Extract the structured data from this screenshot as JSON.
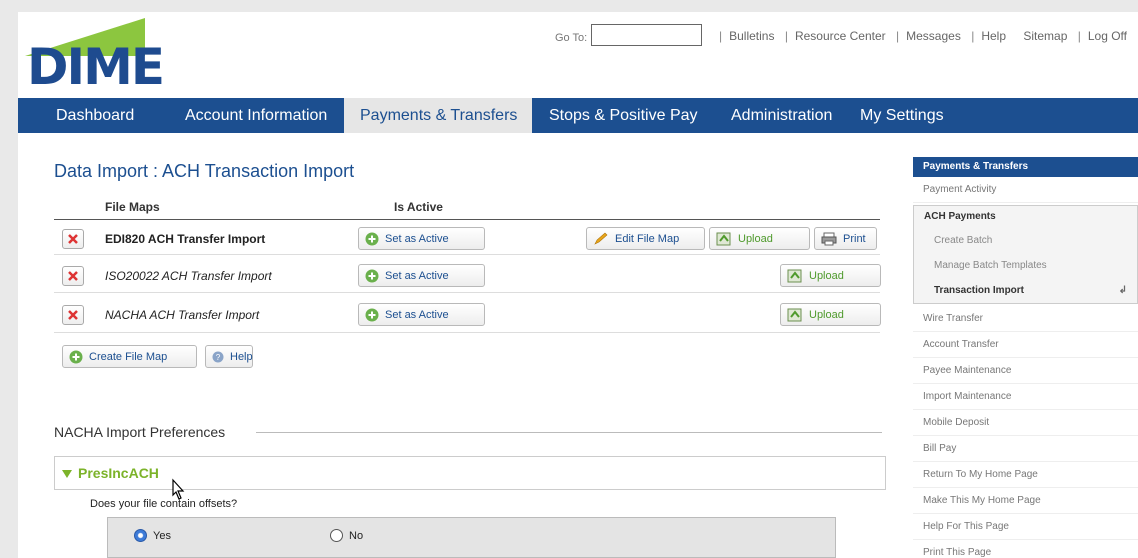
{
  "brand": {
    "logo_text": "DIME",
    "colors": {
      "primary": "#1c4f90",
      "accent_green": "#7cb32a"
    }
  },
  "header": {
    "goto_label": "Go To:",
    "goto_value": "",
    "links": [
      "Bulletins",
      "Resource Center",
      "Messages",
      "Help",
      "Sitemap",
      "Log Off"
    ]
  },
  "nav": {
    "items": [
      "Dashboard",
      "Account Information",
      "Payments & Transfers",
      "Stops & Positive Pay",
      "Administration",
      "My Settings"
    ],
    "active": "Payments & Transfers"
  },
  "main": {
    "title": "Data Import : ACH Transaction Import",
    "table": {
      "col_file_maps": "File Maps",
      "col_is_active": "Is Active",
      "rows": [
        {
          "name": "EDI820 ACH Transfer Import",
          "set_active": "Set as Active",
          "edit": "Edit File Map",
          "upload": "Upload",
          "print": "Print"
        },
        {
          "name": "ISO20022 ACH Transfer Import",
          "set_active": "Set as Active",
          "upload": "Upload"
        },
        {
          "name": "NACHA ACH Transfer Import",
          "set_active": "Set as Active",
          "upload": "Upload"
        }
      ]
    },
    "create_file_map": "Create File Map",
    "help": "Help",
    "prefs_title": "NACHA Import Preferences",
    "collapse_title": "PresIncACH",
    "question": "Does your file contain offsets?",
    "radio_yes": "Yes",
    "radio_no": "No",
    "radio_selected": "Yes"
  },
  "sidebar": {
    "header": "Payments & Transfers",
    "payment_activity": "Payment Activity",
    "group_title": "ACH Payments",
    "group_items": [
      "Create Batch",
      "Manage Batch Templates",
      "Transaction Import"
    ],
    "active_item": "Transaction Import",
    "items": [
      "Wire Transfer",
      "Account Transfer",
      "Payee Maintenance",
      "Import Maintenance",
      "Mobile Deposit",
      "Bill Pay",
      "Return To My Home Page",
      "Make This My Home Page",
      "Help For This Page",
      "Print This Page"
    ]
  }
}
